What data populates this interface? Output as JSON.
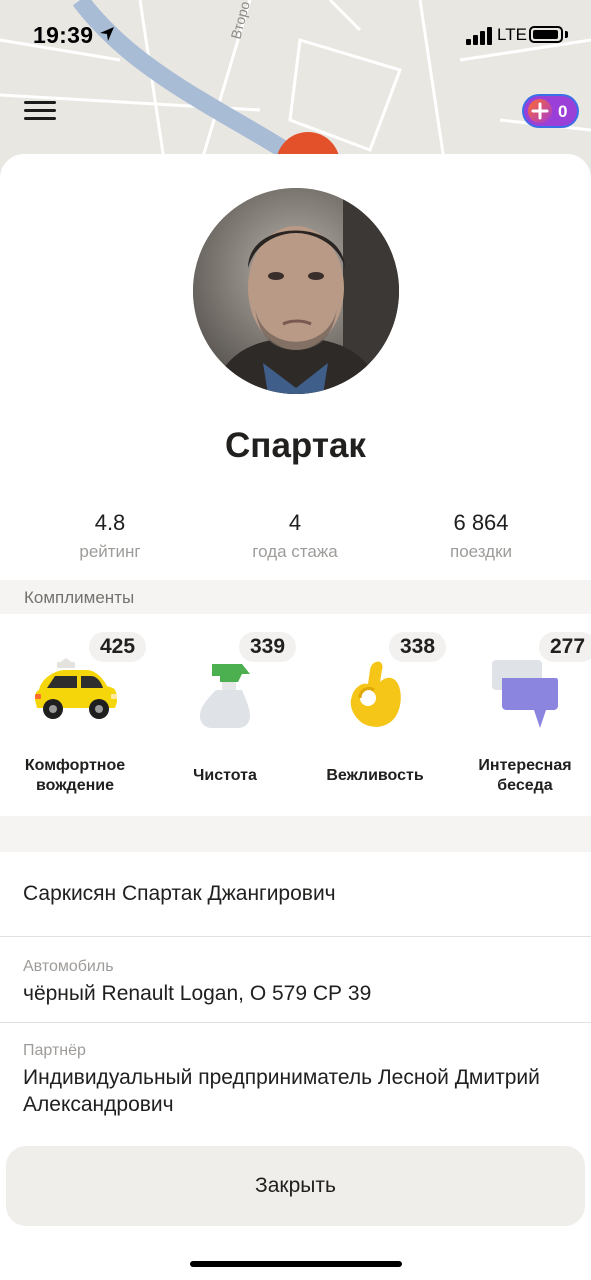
{
  "status_bar": {
    "time": "19:39",
    "network": "LTE"
  },
  "map": {
    "street_label": "Второ"
  },
  "plus_badge": {
    "count": "0"
  },
  "driver": {
    "name": "Спартак",
    "full_name": "Саркисян Спартак Джангирович"
  },
  "stats": [
    {
      "value": "4.8",
      "label": "рейтинг"
    },
    {
      "value": "4",
      "label": "года стажа"
    },
    {
      "value": "6 864",
      "label": "поездки"
    }
  ],
  "compliments": {
    "title": "Комплименты",
    "items": [
      {
        "count": "425",
        "label_line1": "Комфортное",
        "label_line2": "вождение",
        "icon": "taxi-car-icon"
      },
      {
        "count": "339",
        "label_line1": "Чистота",
        "label_line2": "",
        "icon": "spray-bottle-icon"
      },
      {
        "count": "338",
        "label_line1": "Вежливость",
        "label_line2": "",
        "icon": "ok-hand-icon"
      },
      {
        "count": "277",
        "label_line1": "Интересная",
        "label_line2": "беседа",
        "icon": "chat-bubbles-icon"
      }
    ]
  },
  "vehicle": {
    "label": "Автомобиль",
    "value": "чёрный Renault Logan, О 579 СР 39"
  },
  "partner": {
    "label": "Партнёр",
    "value": "Индивидуальный предприниматель Лесной Дмитрий Александрович"
  },
  "close_button": {
    "label": "Закрыть"
  },
  "colors": {
    "accent_orange": "#e3512a",
    "taxi_yellow": "#f5d60a",
    "text_primary": "#21201f",
    "text_secondary": "#9e9b98",
    "section_bg": "#f5f4f2"
  }
}
